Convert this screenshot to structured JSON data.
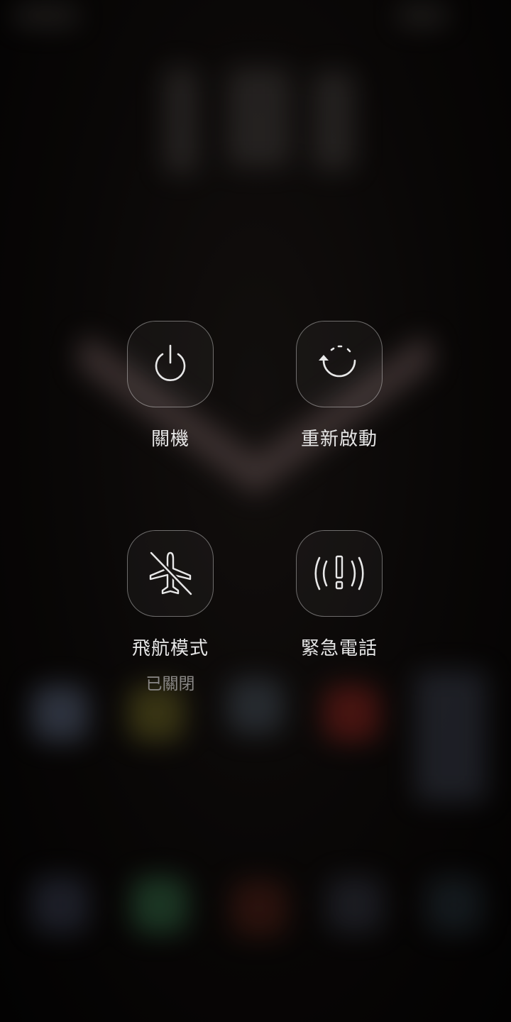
{
  "power_menu": {
    "power_off": {
      "label": "關機",
      "icon": "power-icon"
    },
    "restart": {
      "label": "重新啟動",
      "icon": "restart-icon"
    },
    "airplane_mode": {
      "label": "飛航模式",
      "status": "已關閉",
      "icon": "airplane-off-icon"
    },
    "emergency_call": {
      "label": "緊急電話",
      "icon": "emergency-alert-icon"
    }
  },
  "colors": {
    "background": "#0a0807",
    "icon_stroke": "#e8e8e8",
    "label_text": "#e6e6e6",
    "status_text": "#8a8887",
    "button_border": "#6b6a69"
  }
}
